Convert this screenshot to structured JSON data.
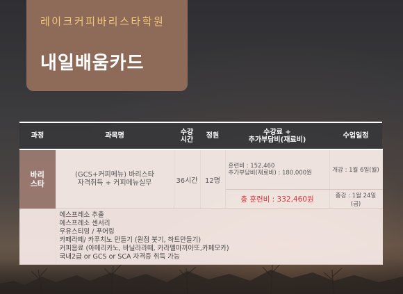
{
  "header": {
    "academy": "레이크커피바리스타학원",
    "title": "내일배움카드"
  },
  "table": {
    "headers": {
      "course": "과정",
      "subject": "과목명",
      "hours": "수강\n시간",
      "capacity": "정원",
      "fee": "수강료 +\n추가부담비(재료비)",
      "schedule": "수업일정"
    },
    "row": {
      "course": "바리\n스타",
      "subject": "(GCS+커피메뉴) 바리스타\n자격취득 + 커피메뉴실무",
      "hours": "36시간",
      "capacity": "12명",
      "fee_training": "훈련비 : 152,460",
      "fee_extra": "추가부담비(재료비) : 180,000원",
      "fee_total": "총 훈련비 : 332,460원",
      "schedule_start": "개강 : 1월 6일(월)",
      "schedule_end": "종강 : 1월 24일(금)"
    },
    "description": [
      "에스프레소 추출",
      "에스프레소 센서리",
      "우유스티밍 / 푸어링",
      "카페라떼/ 카푸치노 만들기 (원점 붓기, 하트만들기)",
      "커피음료 (아메리카노, 바닐라라떼, 카라멜마끼아또,카페모카)",
      "국내2급 or GCS or SCA 자격증 취득 가능"
    ]
  }
}
